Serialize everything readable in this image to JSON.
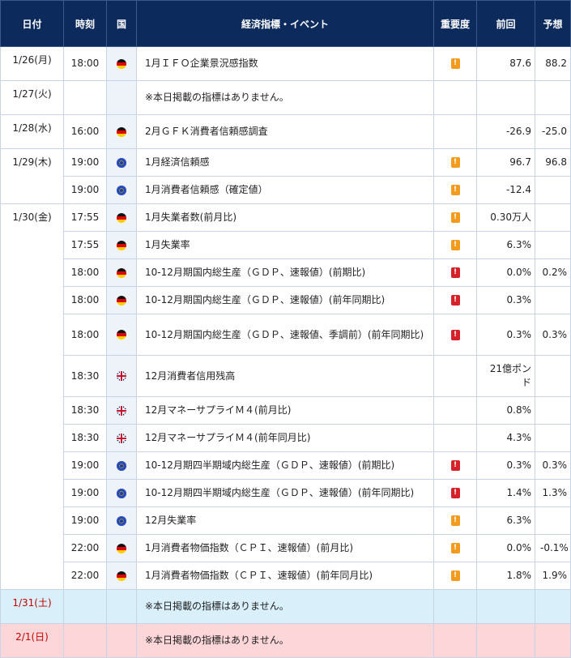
{
  "headers": {
    "date": "日付",
    "time": "時刻",
    "country": "国",
    "event": "経済指標・イベント",
    "importance": "重要度",
    "previous": "前回",
    "forecast": "予想"
  },
  "importance_glyph": "!",
  "colors": {
    "header_bg": "#0c2b5c",
    "importance_mid": "#f39b1c",
    "importance_high": "#d6202a",
    "saturday_bg": "#d9f0fb",
    "sunday_bg": "#fcd6d9"
  },
  "rows": [
    {
      "date": "1/26(月)",
      "time": "18:00",
      "country": "de",
      "event": "1月ＩＦＯ企業景況感指数",
      "importance": "mid",
      "previous": "87.6",
      "forecast": "88.2"
    },
    {
      "date": "1/27(火)",
      "time": "",
      "country": "",
      "event": "※本日掲載の指標はありません。",
      "importance": "",
      "previous": "",
      "forecast": ""
    },
    {
      "date": "1/28(水)",
      "time": "16:00",
      "country": "de",
      "event": "2月ＧＦＫ消費者信頼感調査",
      "importance": "",
      "previous": "-26.9",
      "forecast": "-25.0"
    },
    {
      "date": "1/29(木)",
      "time": "19:00",
      "country": "eu",
      "event": "1月経済信頼感",
      "importance": "mid",
      "previous": "96.7",
      "forecast": "96.8"
    },
    {
      "date": "",
      "time": "19:00",
      "country": "eu",
      "event": "1月消費者信頼感（確定値）",
      "importance": "mid",
      "previous": "-12.4",
      "forecast": ""
    },
    {
      "date": "1/30(金)",
      "time": "17:55",
      "country": "de",
      "event": "1月失業者数(前月比)",
      "importance": "mid",
      "previous": "0.30万人",
      "forecast": ""
    },
    {
      "date": "",
      "time": "17:55",
      "country": "de",
      "event": "1月失業率",
      "importance": "mid",
      "previous": "6.3%",
      "forecast": ""
    },
    {
      "date": "",
      "time": "18:00",
      "country": "de",
      "event": "10-12月期国内総生産（ＧＤＰ、速報値）(前期比)",
      "importance": "high",
      "previous": "0.0%",
      "forecast": "0.2%"
    },
    {
      "date": "",
      "time": "18:00",
      "country": "de",
      "event": "10-12月期国内総生産（ＧＤＰ、速報値）(前年同期比)",
      "importance": "high",
      "previous": "0.3%",
      "forecast": ""
    },
    {
      "date": "",
      "time": "18:00",
      "country": "de",
      "event": "10-12月期国内総生産（ＧＤＰ、速報値、季調前）(前年同期比)",
      "importance": "high",
      "previous": "0.3%",
      "forecast": "0.3%"
    },
    {
      "date": "",
      "time": "18:30",
      "country": "uk",
      "event": "12月消費者信用残高",
      "importance": "",
      "previous": "21億ポンド",
      "forecast": ""
    },
    {
      "date": "",
      "time": "18:30",
      "country": "uk",
      "event": "12月マネーサプライＭ４(前月比)",
      "importance": "",
      "previous": "0.8%",
      "forecast": ""
    },
    {
      "date": "",
      "time": "18:30",
      "country": "uk",
      "event": "12月マネーサプライＭ４(前年同月比)",
      "importance": "",
      "previous": "4.3%",
      "forecast": ""
    },
    {
      "date": "",
      "time": "19:00",
      "country": "eu",
      "event": "10-12月期四半期域内総生産（ＧＤＰ、速報値）(前期比)",
      "importance": "high",
      "previous": "0.3%",
      "forecast": "0.3%"
    },
    {
      "date": "",
      "time": "19:00",
      "country": "eu",
      "event": "10-12月期四半期域内総生産（ＧＤＰ、速報値）(前年同期比)",
      "importance": "high",
      "previous": "1.4%",
      "forecast": "1.3%"
    },
    {
      "date": "",
      "time": "19:00",
      "country": "eu",
      "event": "12月失業率",
      "importance": "mid",
      "previous": "6.3%",
      "forecast": ""
    },
    {
      "date": "",
      "time": "22:00",
      "country": "de",
      "event": "1月消費者物価指数（ＣＰＩ、速報値）(前月比)",
      "importance": "mid",
      "previous": "0.0%",
      "forecast": "-0.1%"
    },
    {
      "date": "",
      "time": "22:00",
      "country": "de",
      "event": "1月消費者物価指数（ＣＰＩ、速報値）(前年同月比)",
      "importance": "mid",
      "previous": "1.8%",
      "forecast": "1.9%"
    },
    {
      "date": "1/31(土)",
      "time": "",
      "country": "",
      "event": "※本日掲載の指標はありません。",
      "importance": "",
      "previous": "",
      "forecast": ""
    },
    {
      "date": "2/1(日)",
      "time": "",
      "country": "",
      "event": "※本日掲載の指標はありません。",
      "importance": "",
      "previous": "",
      "forecast": ""
    }
  ]
}
